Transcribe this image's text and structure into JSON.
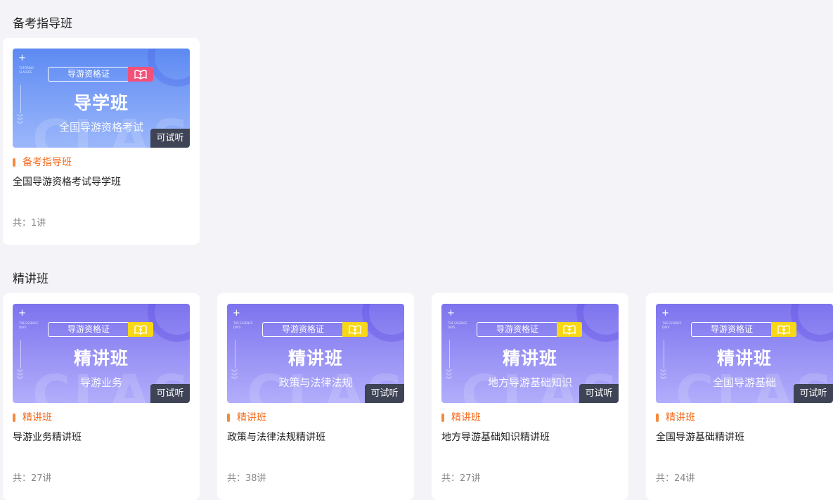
{
  "sections": [
    {
      "title": "备考指导班",
      "cards": [
        {
          "tag": "导游资格证",
          "big_title": "导学班",
          "subtitle": "全国导游资格考试",
          "bg_letters": "CLASS",
          "tiny_text": "TUTORING CLASSES",
          "badge": "可试听",
          "category": "备考指导班",
          "name": "全国导游资格考试导学班",
          "count": "共：1讲",
          "theme": "blue",
          "icon_color": "#f3507a"
        }
      ]
    },
    {
      "title": "精讲班",
      "cards": [
        {
          "tag": "导游资格证",
          "big_title": "精讲班",
          "subtitle": "导游业务",
          "bg_letters": "CLASS",
          "tiny_text": "THE ESSENCE DAYS",
          "badge": "可试听",
          "category": "精讲班",
          "name": "导游业务精讲班",
          "count": "共：27讲",
          "theme": "purple",
          "icon_color": "#f7d716"
        },
        {
          "tag": "导游资格证",
          "big_title": "精讲班",
          "subtitle": "政策与法律法规",
          "bg_letters": "CLASS",
          "tiny_text": "THE ESSENCE DAYS",
          "badge": "可试听",
          "category": "精讲班",
          "name": "政策与法律法规精讲班",
          "count": "共：38讲",
          "theme": "purple",
          "icon_color": "#f7d716"
        },
        {
          "tag": "导游资格证",
          "big_title": "精讲班",
          "subtitle": "地方导游基础知识",
          "bg_letters": "CLASS",
          "tiny_text": "THE ESSENCE DAYS",
          "badge": "可试听",
          "category": "精讲班",
          "name": "地方导游基础知识精讲班",
          "count": "共：27讲",
          "theme": "purple",
          "icon_color": "#f7d716"
        },
        {
          "tag": "导游资格证",
          "big_title": "精讲班",
          "subtitle": "全国导游基础",
          "bg_letters": "CLASS",
          "tiny_text": "THE ESSENCE DAYS",
          "badge": "可试听",
          "category": "精讲班",
          "name": "全国导游基础精讲班",
          "count": "共：24讲",
          "theme": "purple",
          "icon_color": "#f7d716"
        }
      ]
    }
  ]
}
